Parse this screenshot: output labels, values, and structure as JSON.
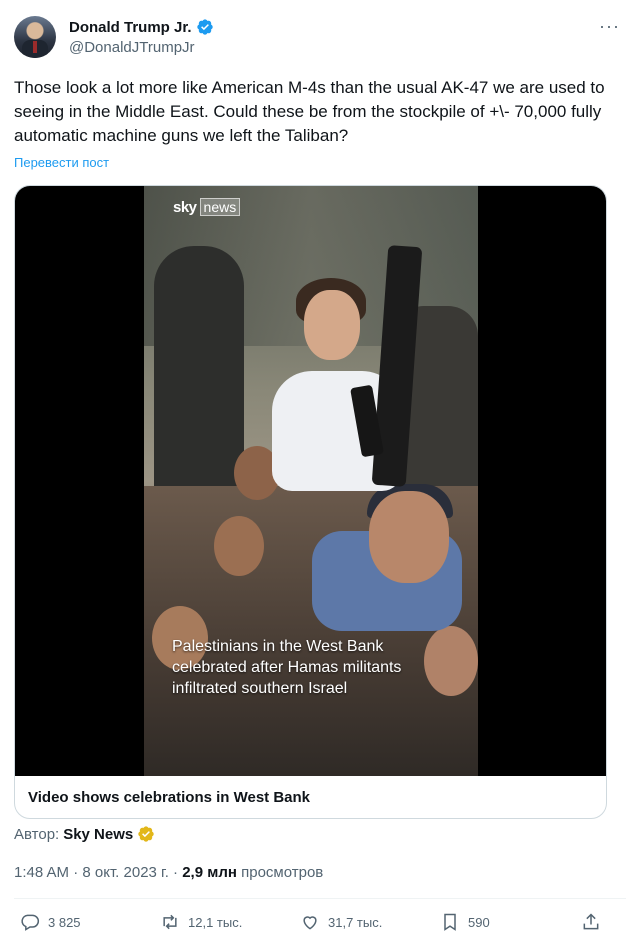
{
  "author": {
    "display_name": "Donald Trump Jr.",
    "handle": "@DonaldJTrumpJr",
    "verified_color": "#1d9bf0"
  },
  "tweet": {
    "text": "Those look a lot more like American M-4s than the usual AK-47 we are used to seeing in the Middle East. Could these be from the stockpile of +\\- 70,000 fully automatic machine guns we left the Taliban?",
    "translate_label": "Перевести пост"
  },
  "media": {
    "brand_sky": "sky",
    "brand_news": "news",
    "caption": "Palestinians in the West Bank celebrated after Hamas militants infiltrated southern Israel",
    "card_title": "Video shows celebrations in West Bank"
  },
  "attribution": {
    "prefix": "Автор:",
    "source": "Sky News",
    "badge_color": "#e2b719"
  },
  "meta": {
    "time": "1:48 AM",
    "separator1": "·",
    "date": "8 окт. 2023 г.",
    "separator2": "·",
    "views_count": "2,9 млн",
    "views_label": "просмотров"
  },
  "actions": {
    "replies": "3 825",
    "reposts": "12,1 тыс.",
    "likes": "31,7 тыс.",
    "bookmarks": "590"
  },
  "icons": [
    "verified-icon",
    "more-icon",
    "reply-icon",
    "repost-icon",
    "like-icon",
    "bookmark-icon",
    "share-icon",
    "gold-verified-icon"
  ]
}
